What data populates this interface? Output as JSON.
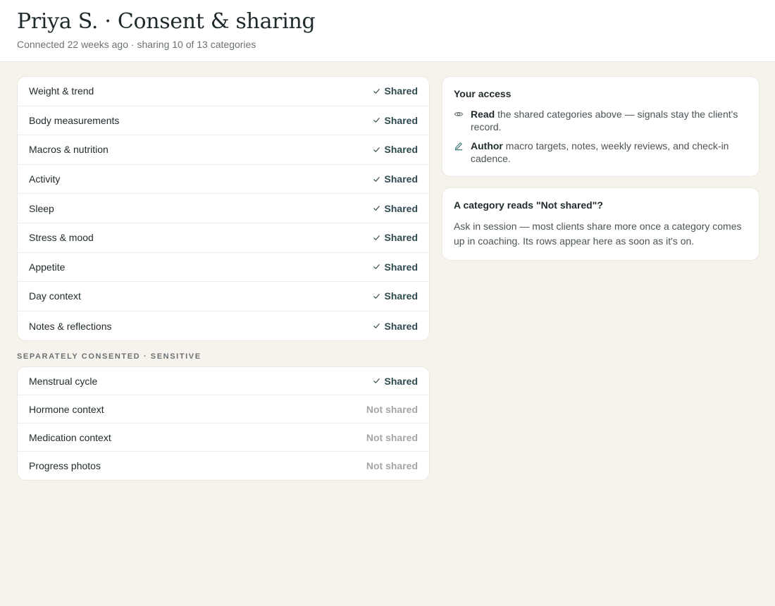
{
  "header": {
    "title": "Priya S. · Consent & sharing",
    "subtitle": "Connected 22 weeks ago · sharing 10 of 13 categories"
  },
  "categories": [
    {
      "label": "Weight & trend",
      "status": "Shared"
    },
    {
      "label": "Body measurements",
      "status": "Shared"
    },
    {
      "label": "Macros & nutrition",
      "status": "Shared"
    },
    {
      "label": "Activity",
      "status": "Shared"
    },
    {
      "label": "Sleep",
      "status": "Shared"
    },
    {
      "label": "Stress & mood",
      "status": "Shared"
    },
    {
      "label": "Appetite",
      "status": "Shared"
    },
    {
      "label": "Day context",
      "status": "Shared"
    },
    {
      "label": "Notes & reflections",
      "status": "Shared"
    }
  ],
  "sensitive": {
    "section_label": "Separately consented · Sensitive",
    "items": [
      {
        "label": "Menstrual cycle",
        "status": "Shared"
      },
      {
        "label": "Hormone context",
        "status": "Not shared"
      },
      {
        "label": "Medication context",
        "status": "Not shared"
      },
      {
        "label": "Progress photos",
        "status": "Not shared"
      }
    ]
  },
  "access": {
    "title": "Your access",
    "items": [
      {
        "icon": "eye-icon",
        "strong": "Read",
        "text": " the shared categories above — signals stay the client's record."
      },
      {
        "icon": "pencil-icon",
        "strong": "Author",
        "text": " macro targets, notes, weekly reviews, and check-in cadence."
      }
    ]
  },
  "help": {
    "title": "A category reads \"Not shared\"?",
    "body": "Ask in session — most clients share more once a category comes up in coaching. Its rows appear here as soon as it's on."
  },
  "colors": {
    "background": "#f6f3ec",
    "shared": "#2f4a4f",
    "not_shared": "#a3a6a6"
  }
}
